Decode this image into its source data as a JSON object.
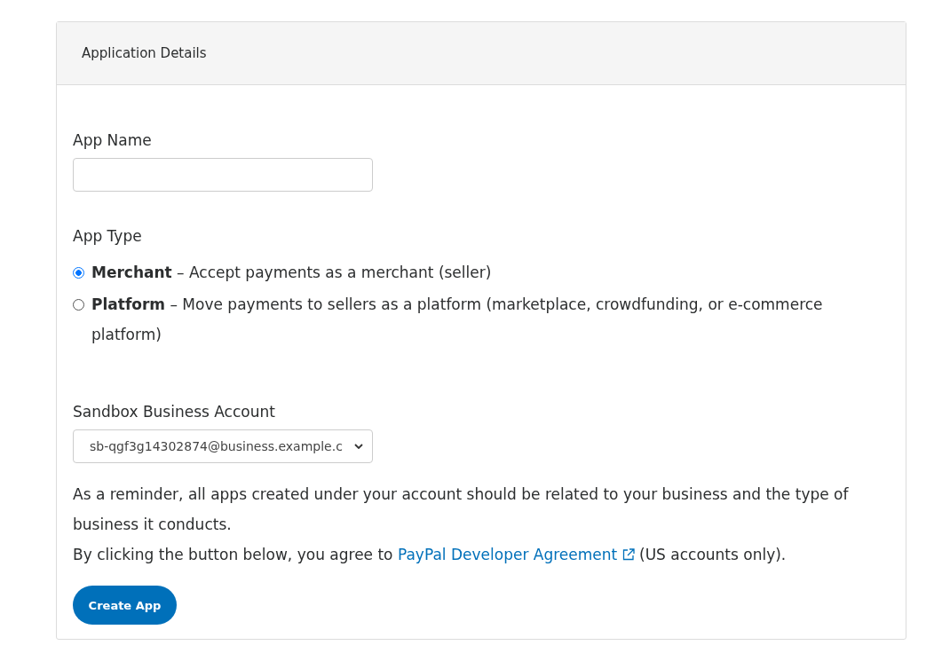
{
  "panel": {
    "title": "Application Details"
  },
  "app_name": {
    "label": "App Name"
  },
  "app_type": {
    "label": "App Type",
    "options": [
      {
        "text": "**Merchant** – Accept payments as a merchant (seller)",
        "selected": true
      },
      {
        "text": "**Platform** – Move payments to sellers as a platform (marketplace, crowdfunding, or e-commerce platform)",
        "selected": false
      }
    ]
  },
  "business_account": {
    "label": "Sandbox Business Account",
    "value": "sb-qgf3g14302874@business.example.c"
  },
  "reminder": "As a reminder, all apps created under your account should be related to your business and the type of business it conducts.",
  "agreement": {
    "before": "By clicking the button below, you agree to",
    "link": "PayPal Developer Agreement",
    "after": "(US accounts only)."
  },
  "button": "Create App"
}
